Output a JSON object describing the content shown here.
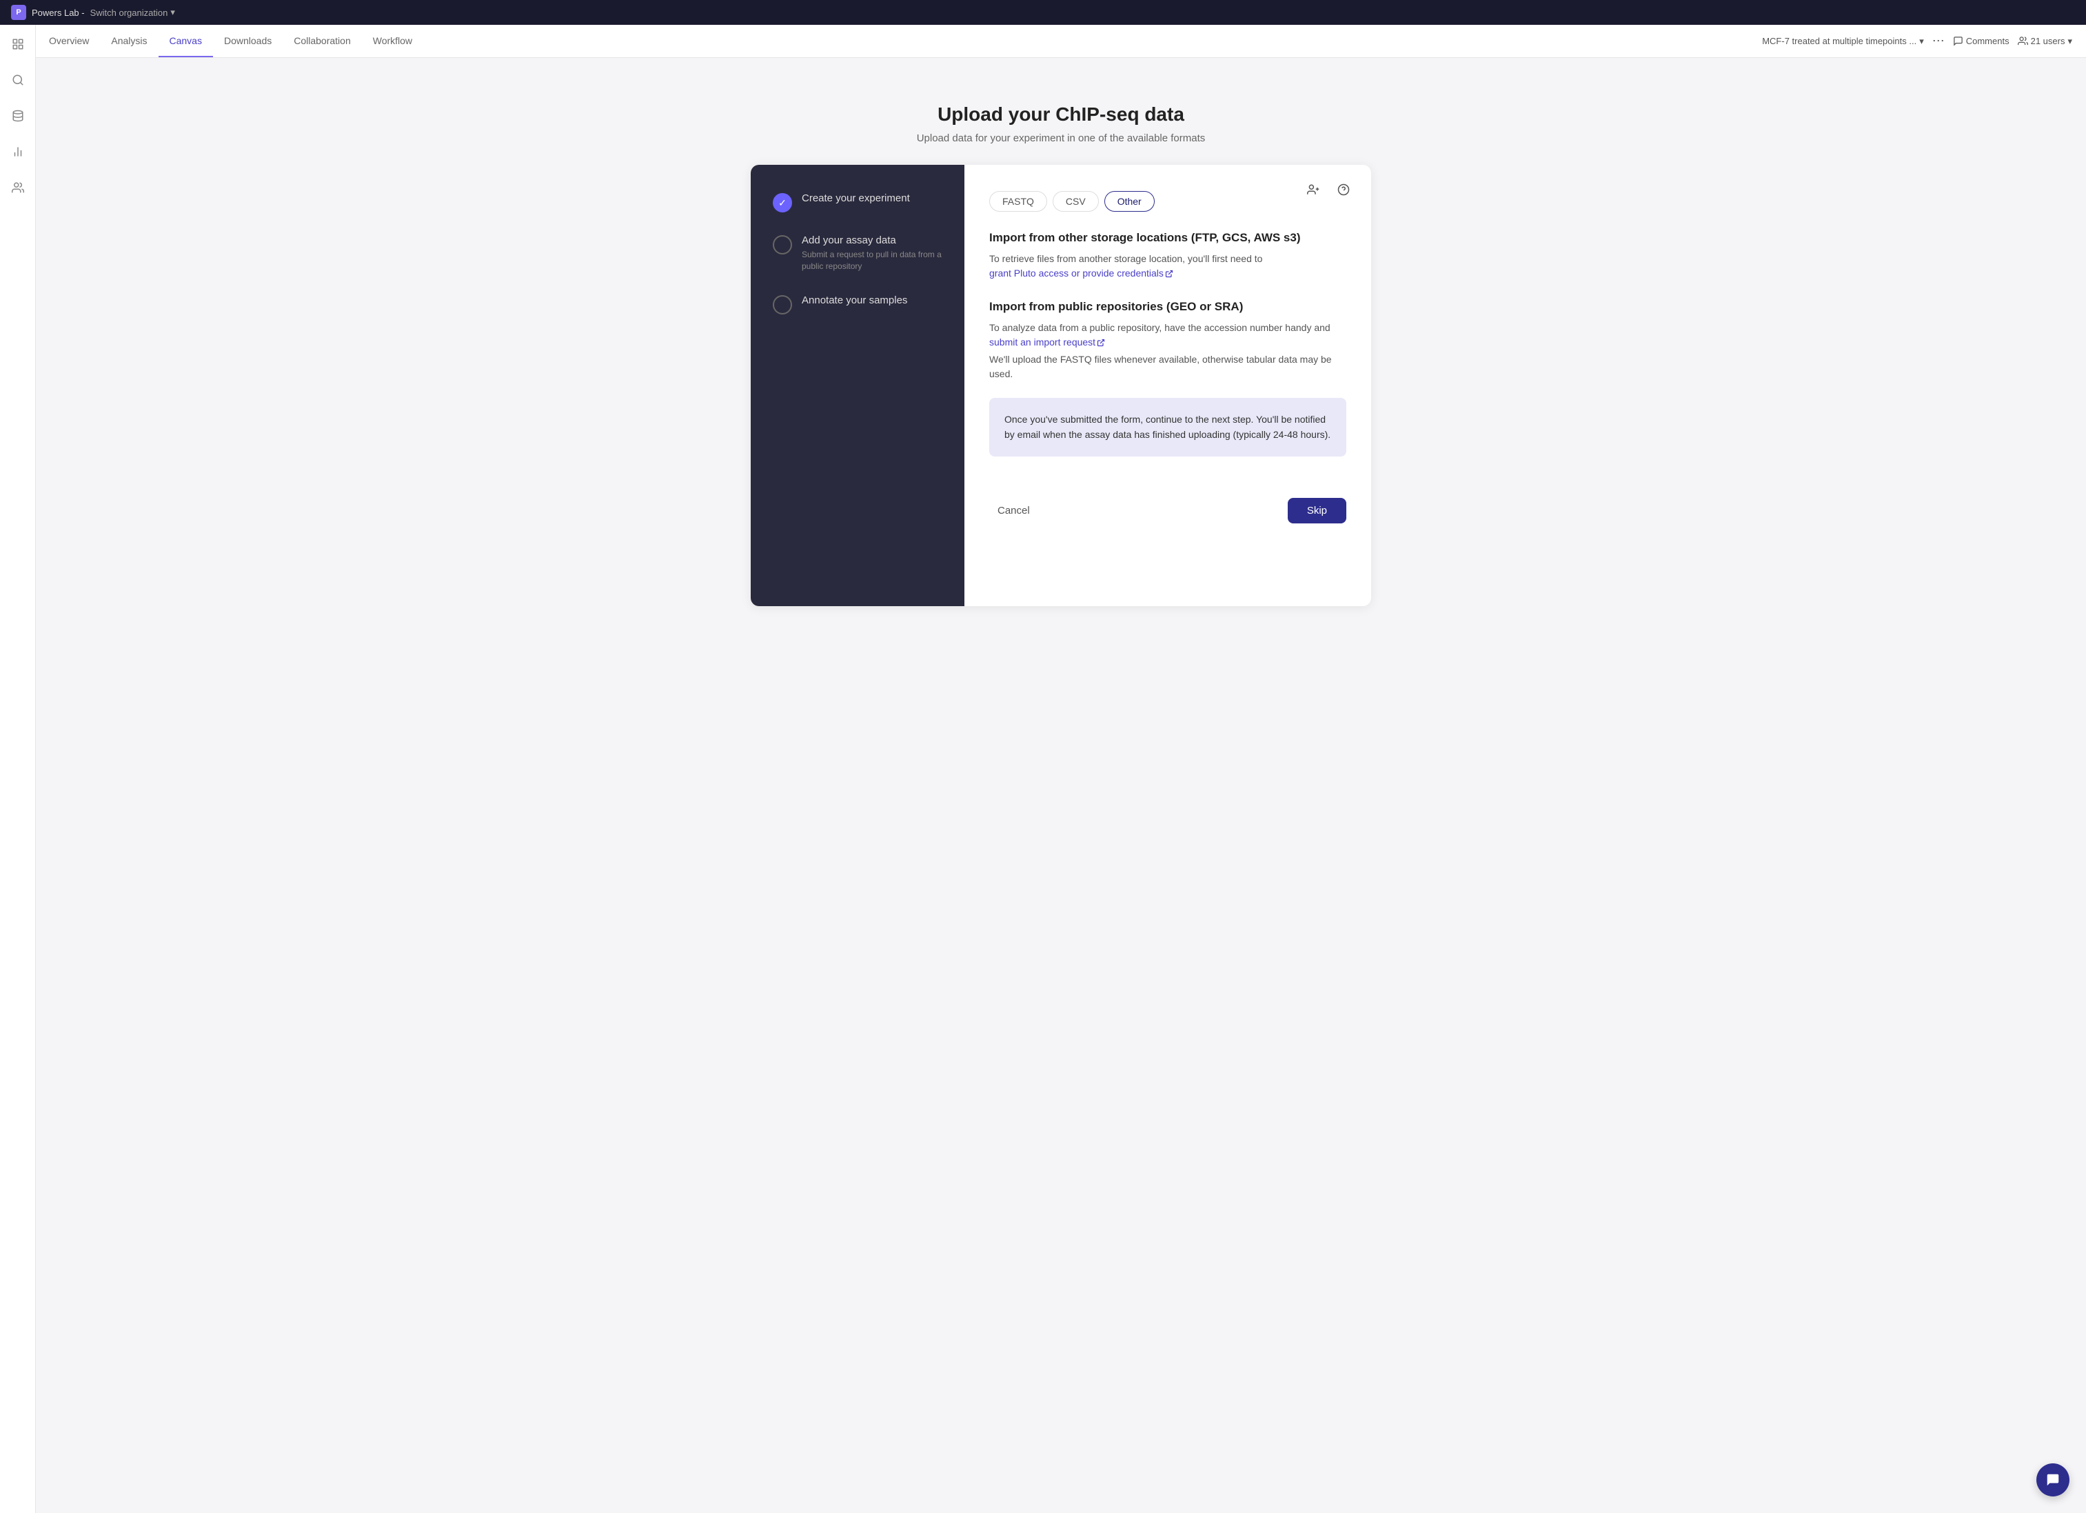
{
  "topbar": {
    "org_name": "Powers Lab -",
    "switch_label": "Switch organization",
    "logo_text": "P"
  },
  "nav": {
    "tabs": [
      {
        "id": "overview",
        "label": "Overview",
        "active": false
      },
      {
        "id": "analysis",
        "label": "Analysis",
        "active": false
      },
      {
        "id": "canvas",
        "label": "Canvas",
        "active": true
      },
      {
        "id": "downloads",
        "label": "Downloads",
        "active": false
      },
      {
        "id": "collaboration",
        "label": "Collaboration",
        "active": false
      },
      {
        "id": "workflow",
        "label": "Workflow",
        "active": false
      }
    ],
    "experiment_name": "MCF-7 treated at multiple timepoints ...",
    "comments_label": "Comments",
    "users_label": "21 users"
  },
  "page": {
    "title": "Upload your ChIP-seq data",
    "subtitle": "Upload data for your experiment in one of the available formats"
  },
  "steps": [
    {
      "id": "create-experiment",
      "title": "Create your experiment",
      "desc": "",
      "completed": true
    },
    {
      "id": "add-assay-data",
      "title": "Add your assay data",
      "desc": "Submit a request to pull in data from a public repository",
      "completed": false
    },
    {
      "id": "annotate-samples",
      "title": "Annotate your samples",
      "desc": "",
      "completed": false
    }
  ],
  "format_tabs": [
    {
      "id": "fastq",
      "label": "FASTQ",
      "active": false
    },
    {
      "id": "csv",
      "label": "CSV",
      "active": false
    },
    {
      "id": "other",
      "label": "Other",
      "active": true
    }
  ],
  "content": {
    "section1_title": "Import from other storage locations (FTP, GCS, AWS s3)",
    "section1_text": "To retrieve files from another storage location, you'll first need to",
    "section1_link": "grant Pluto access or provide credentials",
    "section2_title": "Import from public repositories (GEO or SRA)",
    "section2_text1": "To analyze data from a public repository, have the accession number handy and",
    "section2_link": "submit an import request",
    "section2_text2": "We'll upload the FASTQ files whenever available, otherwise tabular data may be used.",
    "infobox_text": "Once you've submitted the form, continue to the next step. You'll be notified by email when the assay data has finished uploading (typically 24-48 hours)."
  },
  "footer": {
    "cancel_label": "Cancel",
    "skip_label": "Skip"
  },
  "icons": {
    "search": "🔍",
    "layers": "◫",
    "chart": "📊",
    "users": "👥",
    "person_add": "👤+",
    "help": "?",
    "chat": "💬",
    "chevron_down": "▾",
    "more": "⋯",
    "external_link": "↗",
    "checkmark": "✓"
  }
}
